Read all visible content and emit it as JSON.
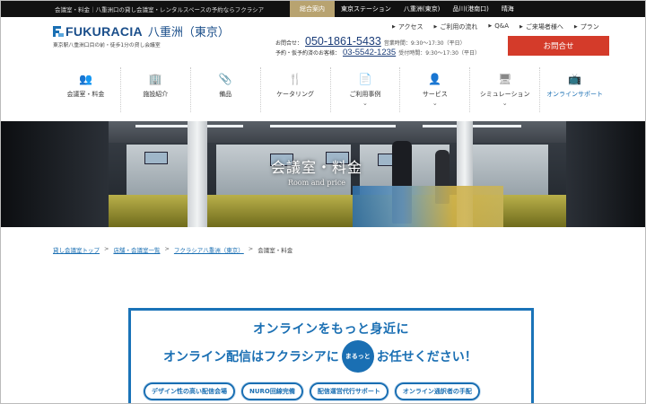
{
  "topbar": {
    "tagline": "会議室・料金｜八重洲口の貸し会議室・レンタルスペースの予約ならフクラシア",
    "links": [
      {
        "label": "総合案内",
        "active": true
      },
      {
        "label": "東京ステーション",
        "active": false
      },
      {
        "label": "八重洲(東京)",
        "active": false
      },
      {
        "label": "品川(港南口)",
        "active": false
      },
      {
        "label": "晴海",
        "active": false
      }
    ]
  },
  "logo": {
    "brand": "FUKURACIA",
    "location": "八重洲（東京）",
    "subtag": "東京駅八重洲口目の前・徒歩1分の貸し会議室"
  },
  "util_links": [
    "アクセス",
    "ご利用の流れ",
    "Q&A",
    "ご来場者様へ",
    "プラン"
  ],
  "contact": {
    "inquiry_label": "お問合せ：",
    "inquiry_number": "050-1861-5433",
    "inquiry_hours": "営業時間：9:30〜17:30（平日）",
    "reserved_label": "予約・仮予約済のお客様：",
    "reserved_number": "03-5542-1235",
    "reserved_hours": "受付時間：9:30〜17:30（平日）"
  },
  "inquiry_button": "お問合せ",
  "nav": [
    {
      "label": "会議室・料金",
      "icon": "users-icon",
      "glyph": "👥",
      "dropdown": false
    },
    {
      "label": "施設紹介",
      "icon": "building-icon",
      "glyph": "🏢",
      "dropdown": false
    },
    {
      "label": "備品",
      "icon": "paperclip-icon",
      "glyph": "📎",
      "dropdown": false
    },
    {
      "label": "ケータリング",
      "icon": "cutlery-icon",
      "glyph": "🍴",
      "dropdown": false
    },
    {
      "label": "ご利用事例",
      "icon": "document-icon",
      "glyph": "📄",
      "dropdown": true
    },
    {
      "label": "サービス",
      "icon": "staff-icon",
      "glyph": "👤",
      "dropdown": true
    },
    {
      "label": "シミュレーション",
      "icon": "monitor-icon",
      "glyph": "🖥",
      "dropdown": true
    },
    {
      "label": "オンラインサポート",
      "icon": "online-support-icon",
      "glyph": "📺",
      "dropdown": false,
      "highlight": true
    }
  ],
  "hero": {
    "title": "会議室・料金",
    "subtitle": "Room and price"
  },
  "breadcrumb": {
    "items": [
      "貸し会議室トップ",
      "店舗・会議室一覧",
      "フクラシア八重洲（東京）"
    ],
    "current": "会議室・料金"
  },
  "banner": {
    "line1": "オンラインをもっと身近に",
    "line2_before": "オンライン配信はフクラシアに",
    "badge": "まるっと",
    "line2_after": "お任せください！",
    "pills": [
      "デザイン性の高い配信会場",
      "NURO回線完備",
      "配信運営代行サポート",
      "オンライン通訳者の手配"
    ]
  },
  "colors": {
    "accent_blue": "#1a6fb3",
    "inquiry_red": "#d43b2a",
    "gold_tab": "#b8a370"
  }
}
